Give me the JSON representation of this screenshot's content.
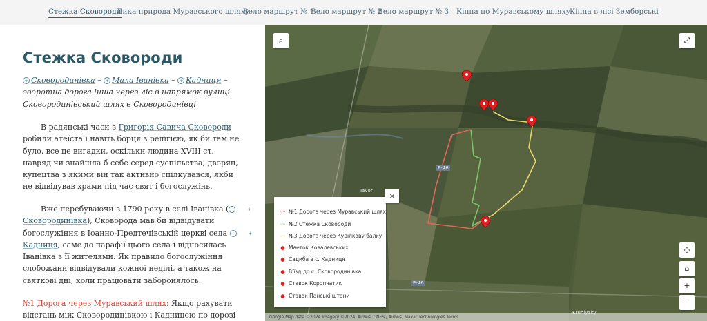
{
  "nav": {
    "items": [
      "Стежка Сковороди",
      "Дика природа Муравського шляху",
      "Вело маршрут № 1",
      "Вело маршрут № 2",
      "Вело маршрут № 3",
      "Кінна по Муравському шляху",
      "Кінна в лісі Земборські"
    ],
    "active": "Стежка Сковороди"
  },
  "article": {
    "title": "Стежка Сковороди",
    "route": {
      "village1": "Сковородинівка",
      "dash1": " – ",
      "village2": "Мала Іванівка",
      "dash2": " – ",
      "village3": "Кадниця",
      "rest": " – зворотна дорога інша через ліс в напрямок вулиці Сковородинівський шлях в Сковородинівці"
    },
    "p1": {
      "before": "В радянські часи з ",
      "link": "Григорія Савича Сковороди",
      "after": " робили атеїста і навіть борця з релігією, як би там не було, все це вигадки, оскільки людина XVIII ст. навряд чи знайшла б себе серед суспільства, дворян, купецтва з якими він так активно спілкувався, якби не відвідував храми під час свят і богослужінь."
    },
    "p2": {
      "before": "Вже перебуваючи з 1790 року в селі Іванівка (",
      "link1": "Сковородинівка",
      "mid": "), Сковорода мав би відвідувати богослужіння в Іоанно-Предтечівській церкві села ",
      "link2": "Кадниця",
      "after": ", саме до парафії цього села і відносилась Іванівка з її жителями. Як правило богослужіння слобожани відвідували кожної неділі, а також на святкові дні, коли працювати заборонялось."
    },
    "p3": {
      "link": "№1 Дорога через Муравський шлях:",
      "after": " Якщо рахувати відстань між Сковородинівкою і Кадницею по дорозі"
    }
  },
  "map": {
    "controls": {
      "search": "⌕",
      "fullscreen": "⤢",
      "locate": "◇",
      "home": "⌂",
      "zoom_in": "+",
      "zoom_out": "−"
    },
    "legend": {
      "close": "×",
      "items": [
        {
          "label": "№1 Дорога через Муравський шлях",
          "icon": "line",
          "color": "#e0685a"
        },
        {
          "label": "№2 Стежка Сковороди",
          "icon": "line",
          "color": "#7ec46a"
        },
        {
          "label": "№3 Дорога через Курілкову балку",
          "icon": "line",
          "color": "#e8d870"
        },
        {
          "label": "Маеток Ковалевських",
          "icon": "pin",
          "color": "#e02020"
        },
        {
          "label": "Садиба в с. Кадниця",
          "icon": "pin",
          "color": "#e02020"
        },
        {
          "label": "В'їзд до с. Сковородинівка",
          "icon": "pin",
          "color": "#e02020"
        },
        {
          "label": "Ставок Коропчатик",
          "icon": "pin",
          "color": "#e02020"
        },
        {
          "label": "Ставок Панські штани",
          "icon": "pin",
          "color": "#e02020"
        }
      ]
    },
    "labels": {
      "tavor": "Tavor",
      "road1": "Р-46",
      "road2": "Р-46",
      "place": "Kruhlyaky"
    },
    "attribution": "Google  Map data ©2024 Imagery ©2024, Airbus, CNES / Airbus, Maxar Technologies  Terms"
  }
}
